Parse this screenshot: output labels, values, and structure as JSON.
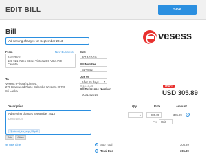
{
  "header": {
    "title": "EDIT BILL",
    "save_label": "Save"
  },
  "document": {
    "title": "Bill",
    "description": "Ad serving charges for September 2013",
    "brand": "vesess"
  },
  "from": {
    "label": "From",
    "new_business_link": "New Business",
    "lines": [
      "Atom3 Inc.",
      "123-921 Yates Street Victoria BC V8V 4Y9",
      "Canada"
    ]
  },
  "to": {
    "label": "To",
    "lines": [
      "Vesess (Private) Limited.",
      "278 Bramwood Place Colombo Western 00700",
      "Sri Lanka"
    ]
  },
  "meta": {
    "date_label": "Date",
    "date_value": "2013-10-10",
    "bill_number_label": "Bill Number",
    "bill_number_value": "BL-0052",
    "due_on_label": "Due on",
    "due_on_value": "After 15 days",
    "due_date": "2013-10-25",
    "bill_ref_label": "Bill Reference Number",
    "bill_ref_value": "0001152014"
  },
  "status": {
    "badge": "DRAFT",
    "total": "USD 305.89"
  },
  "table": {
    "headers": {
      "description": "Description",
      "qty": "Qty.",
      "rate": "Rate",
      "amount": "Amount"
    },
    "item": {
      "description": "Ad serving charges September 2013",
      "placeholder": "Description",
      "attachment": "atom3_inv_sep_13.pdf",
      "qty": "1",
      "rate": "305.89",
      "amount": "305.89",
      "per": "Per",
      "unit": "Unit"
    },
    "mini_buttons": [
      "Date",
      "Attach"
    ]
  },
  "footer": {
    "new_line": "New Line",
    "sub_total_label": "Sub Total",
    "sub_total_value": "305.89",
    "total_label": "Total Due",
    "total_value": "305.89"
  }
}
